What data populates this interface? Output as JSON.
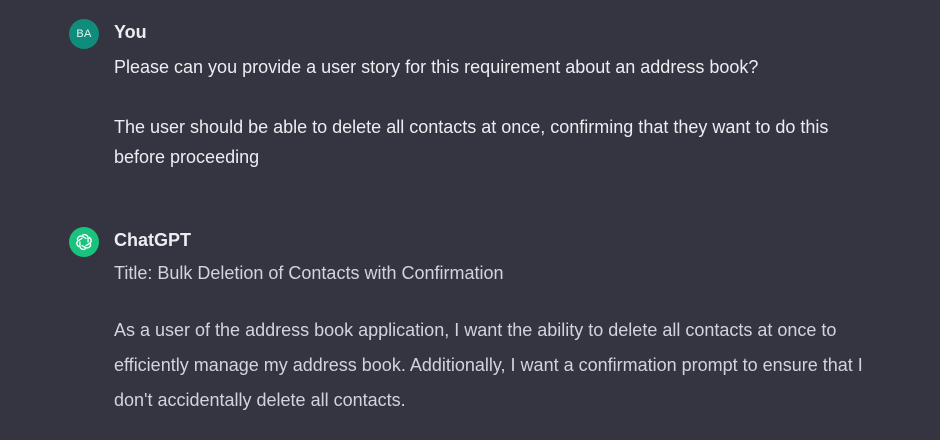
{
  "conversation": {
    "user_message": {
      "avatar_initials": "BA",
      "author": "You",
      "paragraphs": [
        "Please can you provide a user story for this requirement about an address book?",
        "The user should be able to delete all contacts at once, confirming that they want to do this before proceeding"
      ]
    },
    "assistant_message": {
      "avatar_icon": "openai-logo-icon",
      "author": "ChatGPT",
      "title_line": "Title: Bulk Deletion of Contacts with Confirmation",
      "paragraph": "As a user of the address book application, I want the ability to delete all contacts at once to efficiently manage my address book. Additionally, I want a confirmation prompt to ensure that I don't accidentally delete all contacts."
    }
  },
  "colors": {
    "background": "#343541",
    "user_avatar": "#0f8c7b",
    "assistant_avatar": "#19c37d",
    "text": "#ececf1",
    "assistant_text": "#d1d5db"
  }
}
